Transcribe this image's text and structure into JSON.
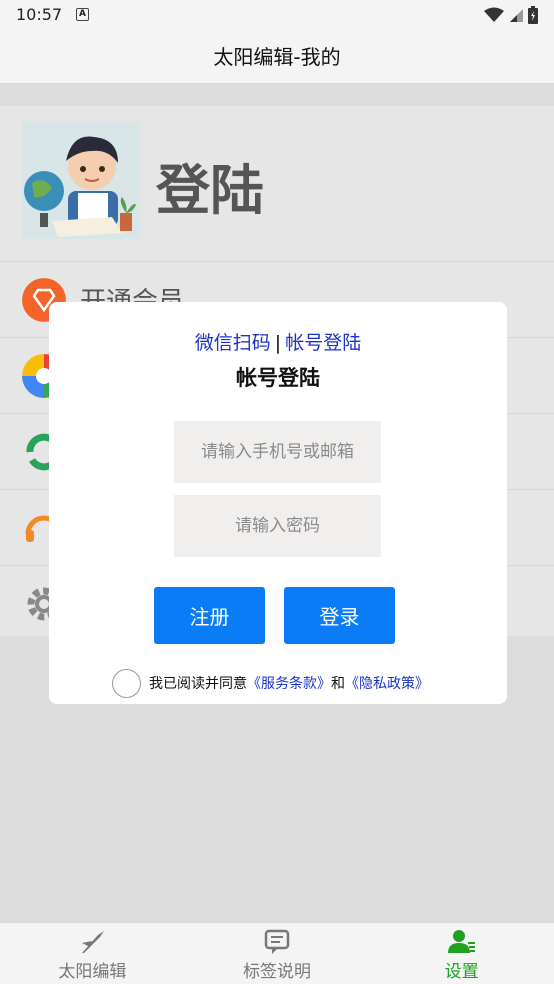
{
  "status_bar": {
    "time": "10:57",
    "notification_badge": "A"
  },
  "title_bar": {
    "title": "太阳编辑-我的"
  },
  "profile": {
    "login_label": "登陆"
  },
  "menu": {
    "items": [
      {
        "label": "开通会员",
        "icon": "diamond-icon",
        "color": "#f2642a"
      },
      {
        "label": "",
        "icon": "aperture-icon",
        "color": "#e94235"
      },
      {
        "label": "",
        "icon": "sync-icon",
        "color": "#27a35a"
      },
      {
        "label": "",
        "icon": "headset-icon",
        "color": "#f08a24"
      },
      {
        "label": "",
        "icon": "gear-icon",
        "color": "#888888"
      }
    ]
  },
  "dialog": {
    "tab_wechat": "微信扫码",
    "tab_separator": "|",
    "tab_account": "帐号登陆",
    "title": "帐号登陆",
    "phone_placeholder": "请输入手机号或邮箱",
    "password_placeholder": "请输入密码",
    "register_button": "注册",
    "login_button": "登录",
    "agree_text": "我已阅读并同意",
    "terms_link": "《服务条款》",
    "and_text": "和",
    "privacy_link": "《隐私政策》",
    "accent_color": "#0a7cf5"
  },
  "bottom_nav": {
    "items": [
      {
        "label": "太阳编辑",
        "icon": "pen-nib-icon"
      },
      {
        "label": "标签说明",
        "icon": "message-icon"
      },
      {
        "label": "设置",
        "icon": "user-settings-icon",
        "active": true
      }
    ],
    "active_color": "#1fa31f"
  }
}
